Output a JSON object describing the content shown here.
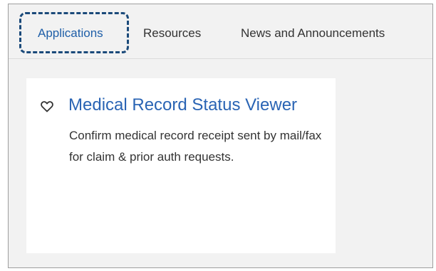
{
  "tabs": [
    {
      "label": "Applications",
      "active": true
    },
    {
      "label": "Resources",
      "active": false
    },
    {
      "label": "News and Announcements",
      "active": false
    }
  ],
  "card": {
    "icon": "heart-outline-icon",
    "title": "Medical Record Status Viewer",
    "description": "Confirm medical record receipt sent by mail/fax for claim & prior auth requests."
  },
  "colors": {
    "accent": "#2a64b4",
    "focus_ring": "#1b4a7a",
    "text": "#333333",
    "panel_background": "#f2f2f2"
  }
}
